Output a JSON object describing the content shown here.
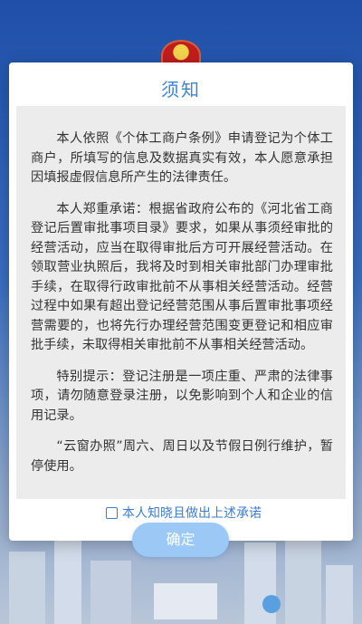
{
  "dialog": {
    "title": "须知",
    "paragraphs": [
      "本人依照《个体工商户条例》申请登记为个体工商户，所填写的信息及数据真实有效，本人愿意承担因填报虚假信息所产生的法律责任。",
      "本人郑重承诺：根据省政府公布的《河北省工商登记后置审批事项目录》要求，如果从事须经审批的经营活动，应当在取得审批后方可开展经营活动。在领取营业执照后，我将及时到相关审批部门办理审批手续，在取得行政审批前不从事相关经营活动。经营过程中如果有超出登记经营范围从事后置审批事项经营需要的，也将先行办理经营范围变更登记和相应审批手续，未取得相关审批前不从事相关经营活动。",
      "特别提示：登记注册是一项庄重、严肃的法律事项，请勿随意登录注册，以免影响到个人和企业的信用记录。",
      "“云窗办照”周六、周日以及节假日例行维护，暂停使用。"
    ],
    "agree_label": "本人知晓且做出上述承诺",
    "agree_checked": false,
    "confirm_label": "确定"
  },
  "colors": {
    "accent": "#3a86d6",
    "button": "#9cc8f6",
    "content_bg": "#ececec",
    "page_bg": "#2f5fb0"
  },
  "icons": {
    "emblem": "national-emblem-icon",
    "checkbox": "checkbox-unchecked-icon"
  }
}
